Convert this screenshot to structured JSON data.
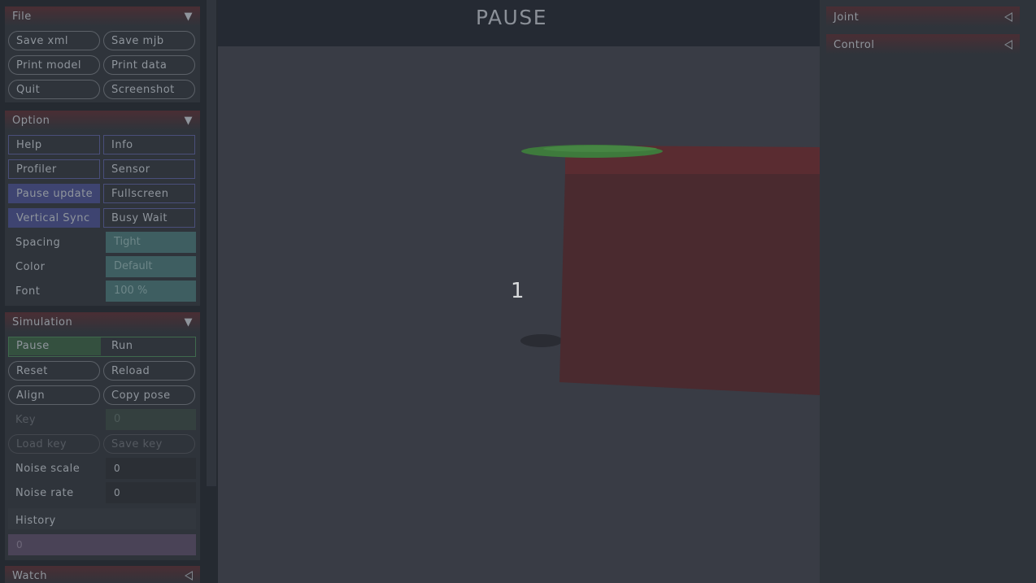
{
  "viewport": {
    "title": "PAUSE",
    "frame_number": "1"
  },
  "file": {
    "header": "File",
    "buttons": [
      "Save xml",
      "Save mjb",
      "Print model",
      "Print data",
      "Quit",
      "Screenshot"
    ]
  },
  "option": {
    "header": "Option",
    "buttons": [
      "Help",
      "Info",
      "Profiler",
      "Sensor",
      "Pause update",
      "Fullscreen",
      "Vertical Sync",
      "Busy Wait"
    ],
    "spacing_label": "Spacing",
    "spacing_value": "Tight",
    "color_label": "Color",
    "color_value": "Default",
    "font_label": "Font",
    "font_value": "100 %"
  },
  "simulation": {
    "header": "Simulation",
    "pause": "Pause",
    "run": "Run",
    "buttons": [
      "Reset",
      "Reload",
      "Align",
      "Copy pose"
    ],
    "key_label": "Key",
    "key_value": "0",
    "load_key": "Load key",
    "save_key": "Save key",
    "noise_scale_label": "Noise scale",
    "noise_scale_value": "0",
    "noise_rate_label": "Noise rate",
    "noise_rate_value": "0",
    "history_label": "History",
    "history_value": "0"
  },
  "watch": {
    "header": "Watch"
  },
  "right_panel": {
    "joint": "Joint",
    "control": "Control"
  },
  "colors": {
    "background": "#393c45",
    "box_red": "#5a2c31",
    "capsule_green": "#3e7a3c"
  }
}
